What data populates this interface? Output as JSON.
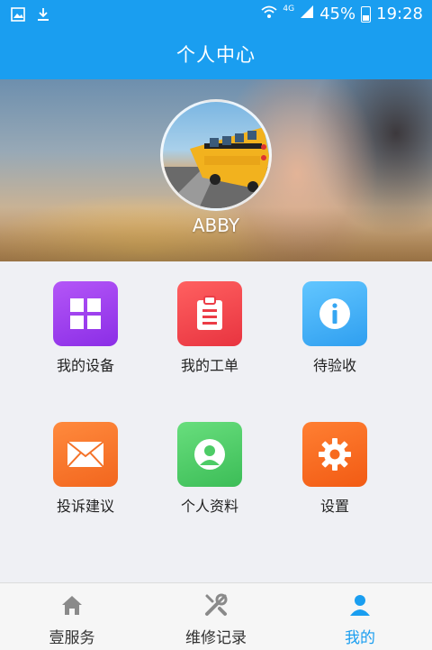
{
  "status_bar": {
    "network": "4G",
    "battery": "45%",
    "time": "19:28",
    "left_icons": [
      "image-notification-icon",
      "download-notification-icon"
    ]
  },
  "header": {
    "title": "个人中心"
  },
  "profile": {
    "username": "ABBY"
  },
  "menu": {
    "items": [
      {
        "label": "我的设备",
        "icon": "grid-icon",
        "color": "#9b3df2"
      },
      {
        "label": "我的工单",
        "icon": "clipboard-icon",
        "color": "#f2474f"
      },
      {
        "label": "待验收",
        "icon": "info-icon",
        "color": "#3aaef4"
      },
      {
        "label": "投诉建议",
        "icon": "envelope-icon",
        "color": "#f7722c"
      },
      {
        "label": "个人资料",
        "icon": "user-icon",
        "color": "#4dcc66"
      },
      {
        "label": "设置",
        "icon": "gear-icon",
        "color": "#f76a1f"
      }
    ]
  },
  "bottom_nav": {
    "items": [
      {
        "label": "壹服务",
        "icon": "home-icon",
        "active": false
      },
      {
        "label": "维修记录",
        "icon": "tools-icon",
        "active": false
      },
      {
        "label": "我的",
        "icon": "person-icon",
        "active": true
      }
    ],
    "active_color": "#1a9ef0",
    "inactive_color": "#333333"
  }
}
